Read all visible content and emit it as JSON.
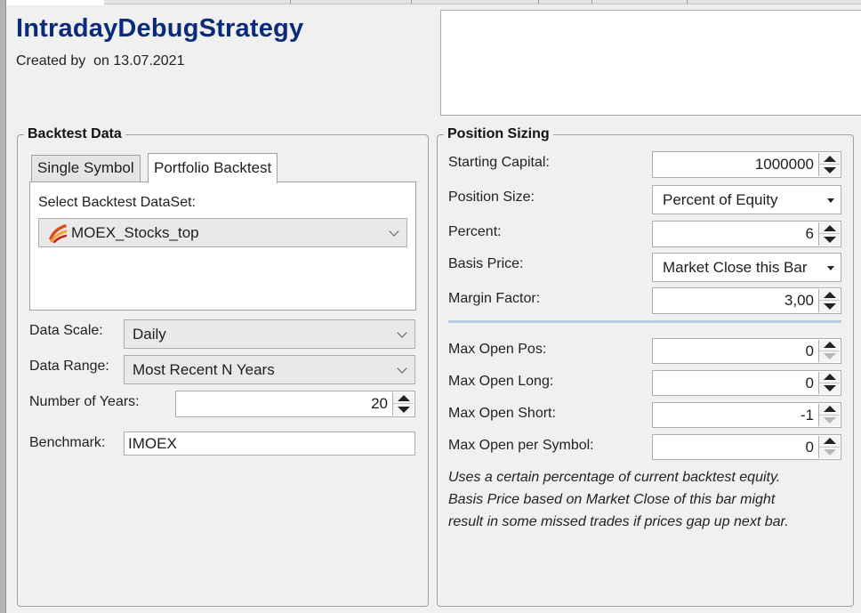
{
  "strategy": {
    "title": "IntradayDebugStrategy",
    "created": "Created by  on 13.07.2021"
  },
  "backtest_data": {
    "group_title": "Backtest Data",
    "tabs": [
      {
        "label": "Single Symbol",
        "active": false
      },
      {
        "label": "Portfolio Backtest",
        "active": true
      }
    ],
    "dataset_label": "Select Backtest DataSet:",
    "dataset_value": "MOEX_Stocks_top",
    "data_scale_label": "Data Scale:",
    "data_scale_value": "Daily",
    "data_range_label": "Data Range:",
    "data_range_value": "Most Recent N Years",
    "num_years_label": "Number of Years:",
    "num_years_value": "20",
    "benchmark_label": "Benchmark:",
    "benchmark_value": "IMOEX"
  },
  "position_sizing": {
    "group_title": "Position Sizing",
    "starting_capital_label": "Starting Capital:",
    "starting_capital_value": "1000000",
    "position_size_label": "Position Size:",
    "position_size_value": "Percent of Equity",
    "percent_label": "Percent:",
    "percent_value": "6",
    "basis_price_label": "Basis Price:",
    "basis_price_value": "Market Close this Bar",
    "margin_factor_label": "Margin Factor:",
    "margin_factor_value": "3,00",
    "max_open_pos_label": "Max Open Pos:",
    "max_open_pos_value": "0",
    "max_open_long_label": "Max Open Long:",
    "max_open_long_value": "0",
    "max_open_short_label": "Max Open Short:",
    "max_open_short_value": "-1",
    "max_open_per_symbol_label": "Max Open per Symbol:",
    "max_open_per_symbol_value": "0",
    "description": [
      "Uses a certain percentage of current backtest equity.",
      "Basis Price based on Market Close of this bar might",
      "result in some missed trades if prices gap up next bar."
    ]
  },
  "icons": {
    "dataset": "dataset-icon",
    "combo_arrow": "chevron-down-icon",
    "spin_up": "spin-up-icon",
    "spin_down": "spin-down-icon"
  },
  "colors": {
    "title": "#0a2a7a",
    "divider": "#b7c9dc"
  }
}
